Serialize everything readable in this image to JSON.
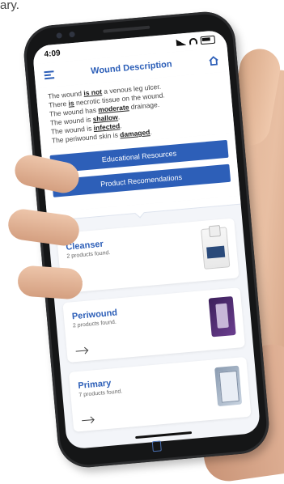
{
  "caption": {
    "text": "ary."
  },
  "status_bar": {
    "time": "4:09"
  },
  "app_bar": {
    "title": "Wound Description"
  },
  "description": {
    "lines": [
      {
        "pre": "The wound ",
        "em": "is not",
        "post": " a venous leg ulcer."
      },
      {
        "pre": "There ",
        "em": "is",
        "post": " necrotic tissue on the wound."
      },
      {
        "pre": "The wound has ",
        "em": "moderate",
        "post": " drainage."
      },
      {
        "pre": "The wound is ",
        "em": "shallow",
        "post": "."
      },
      {
        "pre": "The wound is ",
        "em": "infected",
        "post": "."
      },
      {
        "pre": "The periwound skin is ",
        "em": "damaged",
        "post": "."
      }
    ]
  },
  "buttons": {
    "educational": "Educational Resources",
    "products": "Product Recomendations"
  },
  "cards": [
    {
      "title": "Cleanser",
      "subtitle": "2 products found."
    },
    {
      "title": "Periwound",
      "subtitle": "2 products found."
    },
    {
      "title": "Primary",
      "subtitle": "7 products found."
    }
  ],
  "colors": {
    "accent": "#2d5fb8"
  },
  "icons": {
    "menu": "menu-icon",
    "home": "home-icon",
    "arrow": "arrow-right-icon"
  }
}
